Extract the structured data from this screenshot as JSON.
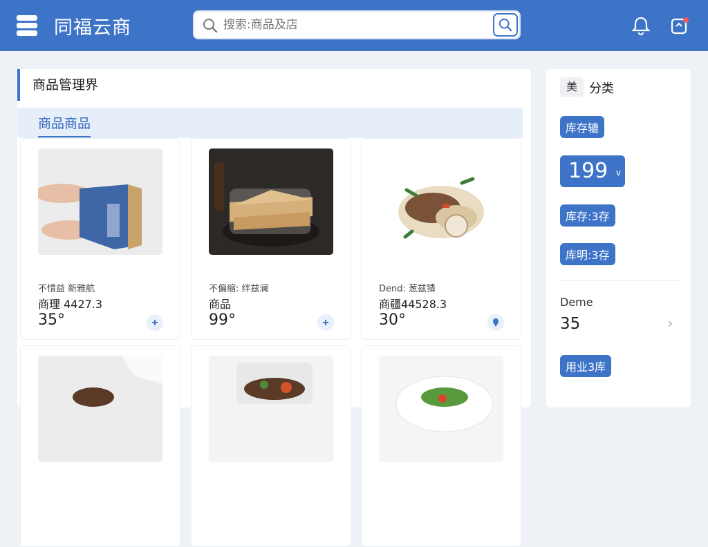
{
  "header": {
    "brand": "同福云商",
    "search_placeholder": "搜索:商品及店"
  },
  "page": {
    "title": "商品管理界",
    "tab": "商品商品"
  },
  "products": [
    {
      "sub": "不惜益 新雅航",
      "name": "商理 4427.3",
      "price": "35°",
      "action": "plus"
    },
    {
      "sub": "不偏缩: 绊兹澜",
      "name": "商品",
      "price": "99°",
      "action": "plus"
    },
    {
      "sub": "Dend: 葱兹猜",
      "name": "商疆44528.3",
      "price": "30°",
      "action": "pin"
    }
  ],
  "sidebar": {
    "icon_label": "美",
    "title": "分类",
    "chip_1": "库存辘",
    "big_value": "199",
    "chip_2": "库存:3存",
    "chip_3": "库明:3存",
    "detail_label": "Deme",
    "detail_value": "35",
    "chip_4": "用业3库"
  },
  "colors": {
    "accent": "#3d74c8"
  }
}
